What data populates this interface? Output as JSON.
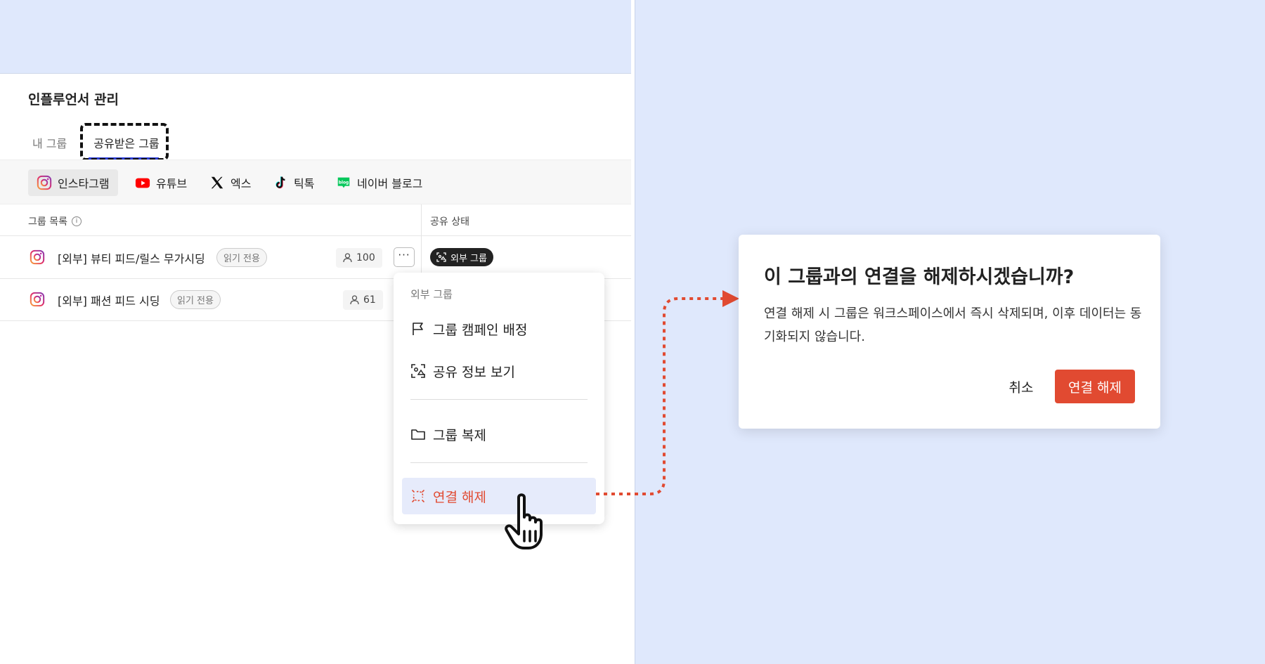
{
  "page": {
    "title": "인플루언서 관리"
  },
  "tabs": [
    {
      "label": "내 그룹"
    },
    {
      "label": "공유받은 그룹"
    }
  ],
  "platforms": [
    {
      "label": "인스타그램",
      "icon": "instagram-icon"
    },
    {
      "label": "유튜브",
      "icon": "youtube-icon"
    },
    {
      "label": "엑스",
      "icon": "x-icon"
    },
    {
      "label": "틱톡",
      "icon": "tiktok-icon"
    },
    {
      "label": "네이버 블로그",
      "icon": "naver-blog-icon",
      "icon_text": "blog"
    }
  ],
  "table": {
    "columns": [
      "그룹 목록",
      "공유 상태"
    ],
    "rows": [
      {
        "name": "[외부] 뷰티 피드/릴스 무가시딩",
        "badge": "읽기 전용",
        "count": "100",
        "status": "외부 그룹"
      },
      {
        "name": "[외부] 패션 피드 시딩",
        "badge": "읽기 전용",
        "count": "61"
      }
    ]
  },
  "dropdown": {
    "header": "외부 그룹",
    "items": [
      {
        "label": "그룹 캠페인 배정",
        "icon": "flag-icon"
      },
      {
        "label": "공유 정보 보기",
        "icon": "share-info-icon"
      },
      {
        "label": "그룹 복제",
        "icon": "folder-icon"
      },
      {
        "label": "연결 해제",
        "icon": "unlink-icon"
      }
    ]
  },
  "dialog": {
    "title": "이 그룹과의 연결을 해제하시겠습니까?",
    "body": "연결 해제 시 그룹은 워크스페이스에서 즉시 삭제되며, 이후 데이터는 동기화되지 않습니다.",
    "cancel": "취소",
    "confirm": "연결 해제"
  },
  "colors": {
    "background": "#dfe8fc",
    "accent": "#e14a31",
    "tab_underline": "#2a3bd6",
    "menu_highlight": "#e6ebfb"
  }
}
